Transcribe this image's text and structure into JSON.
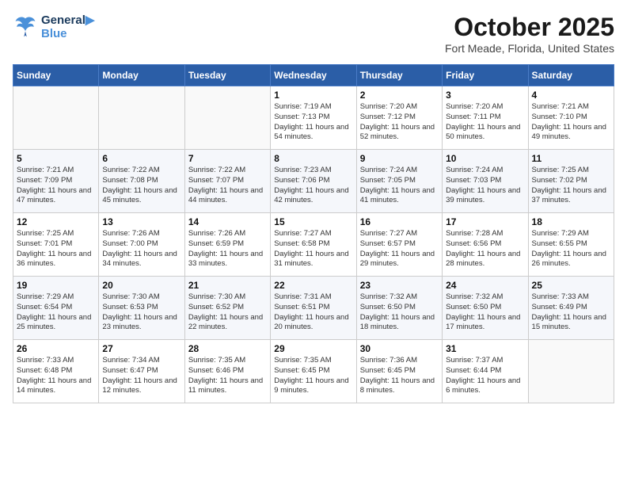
{
  "header": {
    "logo_line1": "General",
    "logo_line2": "Blue",
    "month": "October 2025",
    "location": "Fort Meade, Florida, United States"
  },
  "weekdays": [
    "Sunday",
    "Monday",
    "Tuesday",
    "Wednesday",
    "Thursday",
    "Friday",
    "Saturday"
  ],
  "weeks": [
    [
      {
        "day": "",
        "sunrise": "",
        "sunset": "",
        "daylight": ""
      },
      {
        "day": "",
        "sunrise": "",
        "sunset": "",
        "daylight": ""
      },
      {
        "day": "",
        "sunrise": "",
        "sunset": "",
        "daylight": ""
      },
      {
        "day": "1",
        "sunrise": "Sunrise: 7:19 AM",
        "sunset": "Sunset: 7:13 PM",
        "daylight": "Daylight: 11 hours and 54 minutes."
      },
      {
        "day": "2",
        "sunrise": "Sunrise: 7:20 AM",
        "sunset": "Sunset: 7:12 PM",
        "daylight": "Daylight: 11 hours and 52 minutes."
      },
      {
        "day": "3",
        "sunrise": "Sunrise: 7:20 AM",
        "sunset": "Sunset: 7:11 PM",
        "daylight": "Daylight: 11 hours and 50 minutes."
      },
      {
        "day": "4",
        "sunrise": "Sunrise: 7:21 AM",
        "sunset": "Sunset: 7:10 PM",
        "daylight": "Daylight: 11 hours and 49 minutes."
      }
    ],
    [
      {
        "day": "5",
        "sunrise": "Sunrise: 7:21 AM",
        "sunset": "Sunset: 7:09 PM",
        "daylight": "Daylight: 11 hours and 47 minutes."
      },
      {
        "day": "6",
        "sunrise": "Sunrise: 7:22 AM",
        "sunset": "Sunset: 7:08 PM",
        "daylight": "Daylight: 11 hours and 45 minutes."
      },
      {
        "day": "7",
        "sunrise": "Sunrise: 7:22 AM",
        "sunset": "Sunset: 7:07 PM",
        "daylight": "Daylight: 11 hours and 44 minutes."
      },
      {
        "day": "8",
        "sunrise": "Sunrise: 7:23 AM",
        "sunset": "Sunset: 7:06 PM",
        "daylight": "Daylight: 11 hours and 42 minutes."
      },
      {
        "day": "9",
        "sunrise": "Sunrise: 7:24 AM",
        "sunset": "Sunset: 7:05 PM",
        "daylight": "Daylight: 11 hours and 41 minutes."
      },
      {
        "day": "10",
        "sunrise": "Sunrise: 7:24 AM",
        "sunset": "Sunset: 7:03 PM",
        "daylight": "Daylight: 11 hours and 39 minutes."
      },
      {
        "day": "11",
        "sunrise": "Sunrise: 7:25 AM",
        "sunset": "Sunset: 7:02 PM",
        "daylight": "Daylight: 11 hours and 37 minutes."
      }
    ],
    [
      {
        "day": "12",
        "sunrise": "Sunrise: 7:25 AM",
        "sunset": "Sunset: 7:01 PM",
        "daylight": "Daylight: 11 hours and 36 minutes."
      },
      {
        "day": "13",
        "sunrise": "Sunrise: 7:26 AM",
        "sunset": "Sunset: 7:00 PM",
        "daylight": "Daylight: 11 hours and 34 minutes."
      },
      {
        "day": "14",
        "sunrise": "Sunrise: 7:26 AM",
        "sunset": "Sunset: 6:59 PM",
        "daylight": "Daylight: 11 hours and 33 minutes."
      },
      {
        "day": "15",
        "sunrise": "Sunrise: 7:27 AM",
        "sunset": "Sunset: 6:58 PM",
        "daylight": "Daylight: 11 hours and 31 minutes."
      },
      {
        "day": "16",
        "sunrise": "Sunrise: 7:27 AM",
        "sunset": "Sunset: 6:57 PM",
        "daylight": "Daylight: 11 hours and 29 minutes."
      },
      {
        "day": "17",
        "sunrise": "Sunrise: 7:28 AM",
        "sunset": "Sunset: 6:56 PM",
        "daylight": "Daylight: 11 hours and 28 minutes."
      },
      {
        "day": "18",
        "sunrise": "Sunrise: 7:29 AM",
        "sunset": "Sunset: 6:55 PM",
        "daylight": "Daylight: 11 hours and 26 minutes."
      }
    ],
    [
      {
        "day": "19",
        "sunrise": "Sunrise: 7:29 AM",
        "sunset": "Sunset: 6:54 PM",
        "daylight": "Daylight: 11 hours and 25 minutes."
      },
      {
        "day": "20",
        "sunrise": "Sunrise: 7:30 AM",
        "sunset": "Sunset: 6:53 PM",
        "daylight": "Daylight: 11 hours and 23 minutes."
      },
      {
        "day": "21",
        "sunrise": "Sunrise: 7:30 AM",
        "sunset": "Sunset: 6:52 PM",
        "daylight": "Daylight: 11 hours and 22 minutes."
      },
      {
        "day": "22",
        "sunrise": "Sunrise: 7:31 AM",
        "sunset": "Sunset: 6:51 PM",
        "daylight": "Daylight: 11 hours and 20 minutes."
      },
      {
        "day": "23",
        "sunrise": "Sunrise: 7:32 AM",
        "sunset": "Sunset: 6:50 PM",
        "daylight": "Daylight: 11 hours and 18 minutes."
      },
      {
        "day": "24",
        "sunrise": "Sunrise: 7:32 AM",
        "sunset": "Sunset: 6:50 PM",
        "daylight": "Daylight: 11 hours and 17 minutes."
      },
      {
        "day": "25",
        "sunrise": "Sunrise: 7:33 AM",
        "sunset": "Sunset: 6:49 PM",
        "daylight": "Daylight: 11 hours and 15 minutes."
      }
    ],
    [
      {
        "day": "26",
        "sunrise": "Sunrise: 7:33 AM",
        "sunset": "Sunset: 6:48 PM",
        "daylight": "Daylight: 11 hours and 14 minutes."
      },
      {
        "day": "27",
        "sunrise": "Sunrise: 7:34 AM",
        "sunset": "Sunset: 6:47 PM",
        "daylight": "Daylight: 11 hours and 12 minutes."
      },
      {
        "day": "28",
        "sunrise": "Sunrise: 7:35 AM",
        "sunset": "Sunset: 6:46 PM",
        "daylight": "Daylight: 11 hours and 11 minutes."
      },
      {
        "day": "29",
        "sunrise": "Sunrise: 7:35 AM",
        "sunset": "Sunset: 6:45 PM",
        "daylight": "Daylight: 11 hours and 9 minutes."
      },
      {
        "day": "30",
        "sunrise": "Sunrise: 7:36 AM",
        "sunset": "Sunset: 6:45 PM",
        "daylight": "Daylight: 11 hours and 8 minutes."
      },
      {
        "day": "31",
        "sunrise": "Sunrise: 7:37 AM",
        "sunset": "Sunset: 6:44 PM",
        "daylight": "Daylight: 11 hours and 6 minutes."
      },
      {
        "day": "",
        "sunrise": "",
        "sunset": "",
        "daylight": ""
      }
    ]
  ]
}
